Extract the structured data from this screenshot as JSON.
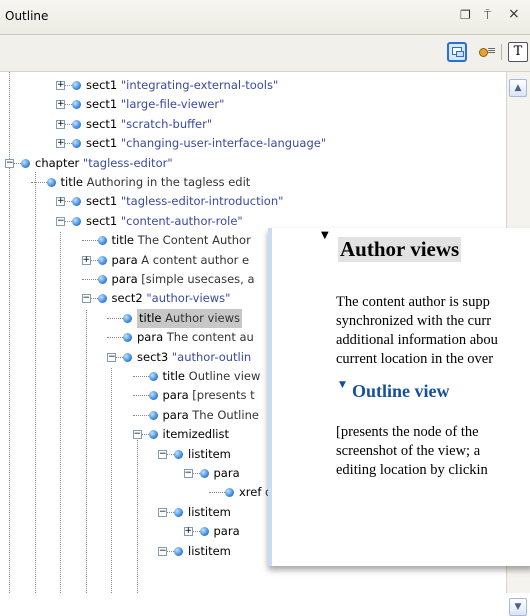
{
  "window": {
    "title": "Outline",
    "restore_glyph": "❐",
    "pin_glyph": "⍑",
    "close_glyph": "×"
  },
  "toolbar": {
    "text_button_label": "T",
    "sync_icon": "sync-selection-icon",
    "filter_icon": "filter-icon"
  },
  "tree": {
    "rows": [
      {
        "expander": "+",
        "name": "sect1",
        "value": "\"integrating-external-tools\""
      },
      {
        "expander": "+",
        "name": "sect1",
        "value": "\"large-file-viewer\""
      },
      {
        "expander": "+",
        "name": "sect1",
        "value": "\"scratch-buffer\""
      },
      {
        "expander": "+",
        "name": "sect1",
        "value": "\"changing-user-interface-language\""
      },
      {
        "expander": "-",
        "name": "chapter",
        "value": "\"tagless-editor\""
      },
      {
        "expander": "",
        "name": "title",
        "value": "Authoring in the tagless edit"
      },
      {
        "expander": "+",
        "name": "sect1",
        "value": "\"tagless-editor-introduction\""
      },
      {
        "expander": "-",
        "name": "sect1",
        "value": "\"content-author-role\""
      },
      {
        "expander": "",
        "name": "title",
        "value": "The Content Author"
      },
      {
        "expander": "+",
        "name": "para",
        "value": "A content author e"
      },
      {
        "expander": "",
        "name": "para",
        "value": "[simple usecases, a"
      },
      {
        "expander": "-",
        "name": "sect2",
        "value": "\"author-views\""
      },
      {
        "expander": "",
        "name": "title",
        "value": "Author views",
        "selected": true
      },
      {
        "expander": "",
        "name": "para",
        "value": "The content au"
      },
      {
        "expander": "-",
        "name": "sect3",
        "value": "\"author-outlin"
      },
      {
        "expander": "",
        "name": "title",
        "value": "Outline view"
      },
      {
        "expander": "",
        "name": "para",
        "value": "[presents t"
      },
      {
        "expander": "",
        "name": "para",
        "value": "The Outline"
      },
      {
        "expander": "-",
        "name": "itemizedlist",
        "value": ""
      },
      {
        "expander": "-",
        "name": "listitem",
        "value": ""
      },
      {
        "expander": "-",
        "name": "para",
        "value": ""
      },
      {
        "expander": "",
        "name": "xref",
        "value": "overview-author-outline"
      },
      {
        "expander": "-",
        "name": "listitem",
        "value": ""
      },
      {
        "expander": "+",
        "name": "para",
        "value": ""
      },
      {
        "expander": "-",
        "name": "listitem",
        "value": ""
      }
    ]
  },
  "preview": {
    "heading": "Author views",
    "paragraph_lines": [
      "The content author is supp",
      "synchronized with the curr",
      "additional information abou",
      "current location in the over"
    ],
    "subheading": "Outline view",
    "sub_lines": [
      "[presents the node of the",
      "screenshot of the view; a",
      "editing location by clickin"
    ]
  },
  "scrollbar": {
    "up_glyph": "▲",
    "down_glyph": "▼"
  },
  "colors": {
    "bullet": "#2b7ad6",
    "value_text": "#3a4aa0",
    "selection": "#c7c7c7",
    "heading_blue": "#16509a"
  }
}
